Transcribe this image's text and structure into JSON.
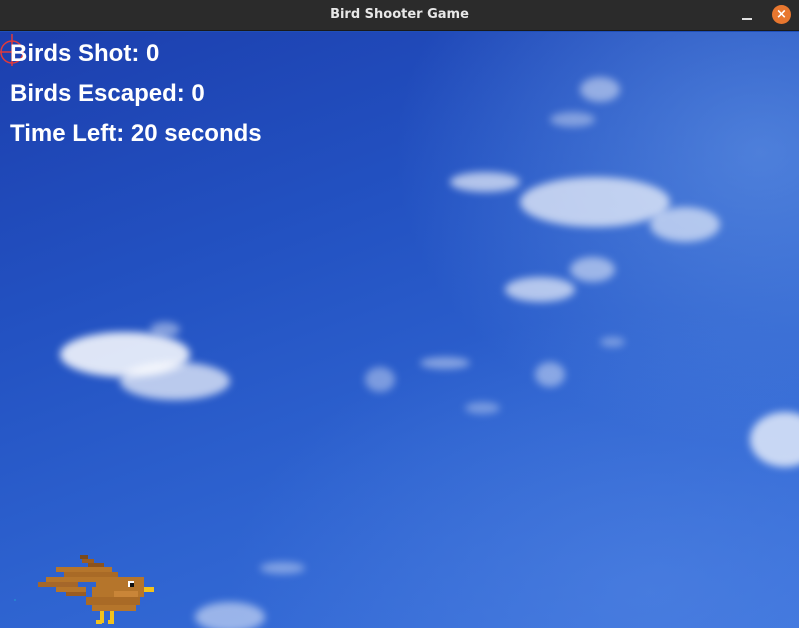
{
  "window": {
    "title": "Bird Shooter Game"
  },
  "hud": {
    "birds_shot": "Birds Shot: 0",
    "birds_escaped": "Birds Escaped: 0",
    "time_left": "Time Left: 20 seconds"
  },
  "colors": {
    "titlebar": "#2b2b2b",
    "close_button": "#e8772f",
    "hud_text": "#ffffff",
    "crosshair": "#e03a3a",
    "bird_brown": "#b5752b",
    "bird_beak": "#f2c21c"
  },
  "icons": {
    "minimize": "minimize-icon",
    "close": "close-icon",
    "crosshair": "crosshair-icon",
    "bird": "bird-sprite"
  }
}
